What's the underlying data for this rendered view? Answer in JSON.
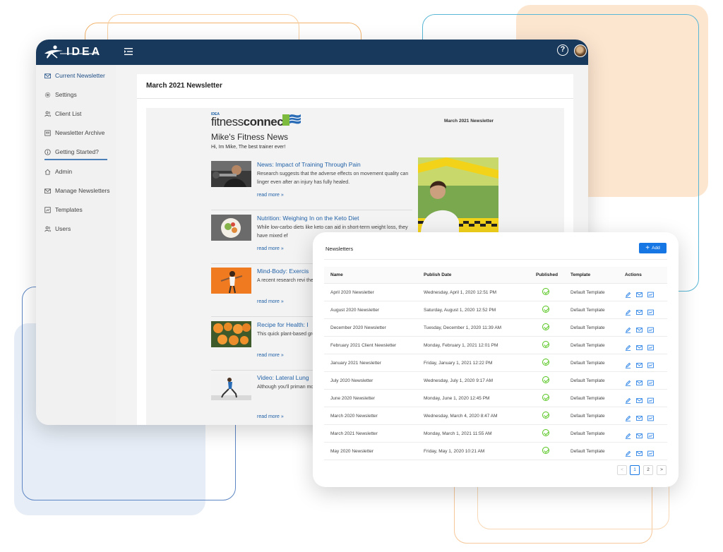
{
  "app": {
    "brand": "IDEA",
    "help_glyph": "?",
    "icons": {
      "menu": "menu-collapse-icon",
      "help": "question-circle-icon",
      "avatar": "user-avatar"
    }
  },
  "sidebar": {
    "items": [
      {
        "label": "Current Newsletter",
        "icon": "mail-icon",
        "active": true
      },
      {
        "label": "Settings",
        "icon": "gear-icon",
        "active": false
      },
      {
        "label": "Client List",
        "icon": "users-icon",
        "active": false
      },
      {
        "label": "Newsletter Archive",
        "icon": "archive-icon",
        "active": false
      },
      {
        "label": "Getting Started?",
        "icon": "info-circle-icon",
        "active": false
      },
      {
        "label": "Admin",
        "icon": "home-icon",
        "active": false
      },
      {
        "label": "Manage Newsletters",
        "icon": "mail-icon",
        "active": false
      },
      {
        "label": "Templates",
        "icon": "template-icon",
        "active": false
      },
      {
        "label": "Users",
        "icon": "users-icon",
        "active": false
      }
    ]
  },
  "main": {
    "panel_title": "March 2021 Newsletter"
  },
  "newsletter": {
    "brand_small": "IDEA",
    "brand_light": "fitness",
    "brand_bold": "connect",
    "date": "March 2021 Newsletter",
    "title": "Mike's Fitness News",
    "greeting": "Hi, Im Mike, The best trainer ever!",
    "articles": [
      {
        "title": "News: Impact of Training Through Pain",
        "text": "Research suggests that the adverse effects on movement quality can linger even after an injury has fully healed.",
        "more": "read more »"
      },
      {
        "title": "Nutrition: Weighing In on the Keto Diet",
        "text": "While low-carbo diets like keto can aid in short-term weight loss, they have mixed ef",
        "more": "read more »"
      },
      {
        "title": "Mind-Body: Exercis",
        "text": "A recent research revi the relationship betwe",
        "more": "read more »"
      },
      {
        "title": "Recipe for Health: I",
        "text": "This quick plant-based great way to maintain",
        "more": "read more »"
      },
      {
        "title": "Video: Lateral Lung",
        "text": "Although you'll priman move in your lower bc requires a strong, stal",
        "more": "read more »"
      }
    ]
  },
  "newsletters_card": {
    "title": "Newsletters",
    "add_label": "Add",
    "columns": {
      "name": "Name",
      "publish_date": "Publish Date",
      "published": "Published",
      "template": "Template",
      "actions": "Actions"
    },
    "rows": [
      {
        "name": "April 2020 Newsletter",
        "date": "Wednesday, April 1, 2020 12:51 PM",
        "published": true,
        "template": "Default Template"
      },
      {
        "name": "August 2020 Newsletter",
        "date": "Saturday, August 1, 2020 12:52 PM",
        "published": true,
        "template": "Default Template"
      },
      {
        "name": "December 2020 Newsletter",
        "date": "Tuesday, December 1, 2020 11:39 AM",
        "published": true,
        "template": "Default Template"
      },
      {
        "name": "February 2021 Client Newsletter",
        "date": "Monday, February 1, 2021 12:01 PM",
        "published": true,
        "template": "Default Template"
      },
      {
        "name": "January 2021 Newsletter",
        "date": "Friday, January 1, 2021 12:22 PM",
        "published": true,
        "template": "Default Template"
      },
      {
        "name": "July 2020 Newsletter",
        "date": "Wednesday, July 1, 2020 9:17 AM",
        "published": true,
        "template": "Default Template"
      },
      {
        "name": "June 2020 Newsletter",
        "date": "Monday, June 1, 2020 12:45 PM",
        "published": true,
        "template": "Default Template"
      },
      {
        "name": "March 2020 Newsletter",
        "date": "Wednesday, March 4, 2020 8:47 AM",
        "published": true,
        "template": "Default Template"
      },
      {
        "name": "March 2021 Newsletter",
        "date": "Monday, March 1, 2021 11:55 AM",
        "published": true,
        "template": "Default Template"
      },
      {
        "name": "May 2020 Newsletter",
        "date": "Friday, May 1, 2020 10:21 AM",
        "published": true,
        "template": "Default Template"
      }
    ],
    "action_icons": [
      "edit-icon",
      "mail-icon",
      "preview-icon"
    ],
    "pagination": {
      "prev": "<",
      "pages": [
        "1",
        "2"
      ],
      "current": "1",
      "next": ">"
    }
  },
  "colors": {
    "topbar": "#18395b",
    "accent": "#1677e4",
    "link": "#2262a8",
    "success": "#52c41a"
  }
}
